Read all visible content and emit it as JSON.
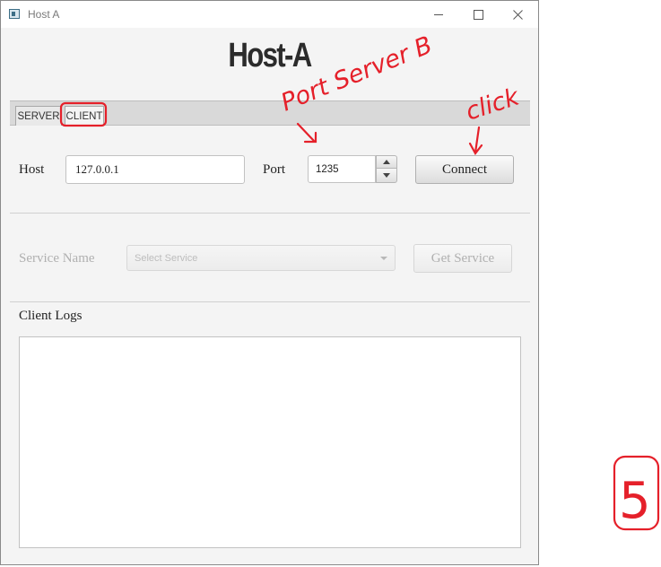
{
  "window": {
    "title": "Host A"
  },
  "app": {
    "heading": "Host-A"
  },
  "tabs": [
    {
      "label": "SERVER"
    },
    {
      "label": "CLIENT"
    }
  ],
  "connection": {
    "host_label": "Host",
    "host_value": "127.0.0.1",
    "port_label": "Port",
    "port_value": "1235",
    "connect_label": "Connect"
  },
  "service": {
    "label": "Service Name",
    "select_placeholder": "Select Service",
    "get_label": "Get Service"
  },
  "logs": {
    "label": "Client Logs"
  },
  "annotations": {
    "port_note": "Port Server B",
    "click_note": "click",
    "step_number": "5",
    "color": "#e5202a"
  }
}
